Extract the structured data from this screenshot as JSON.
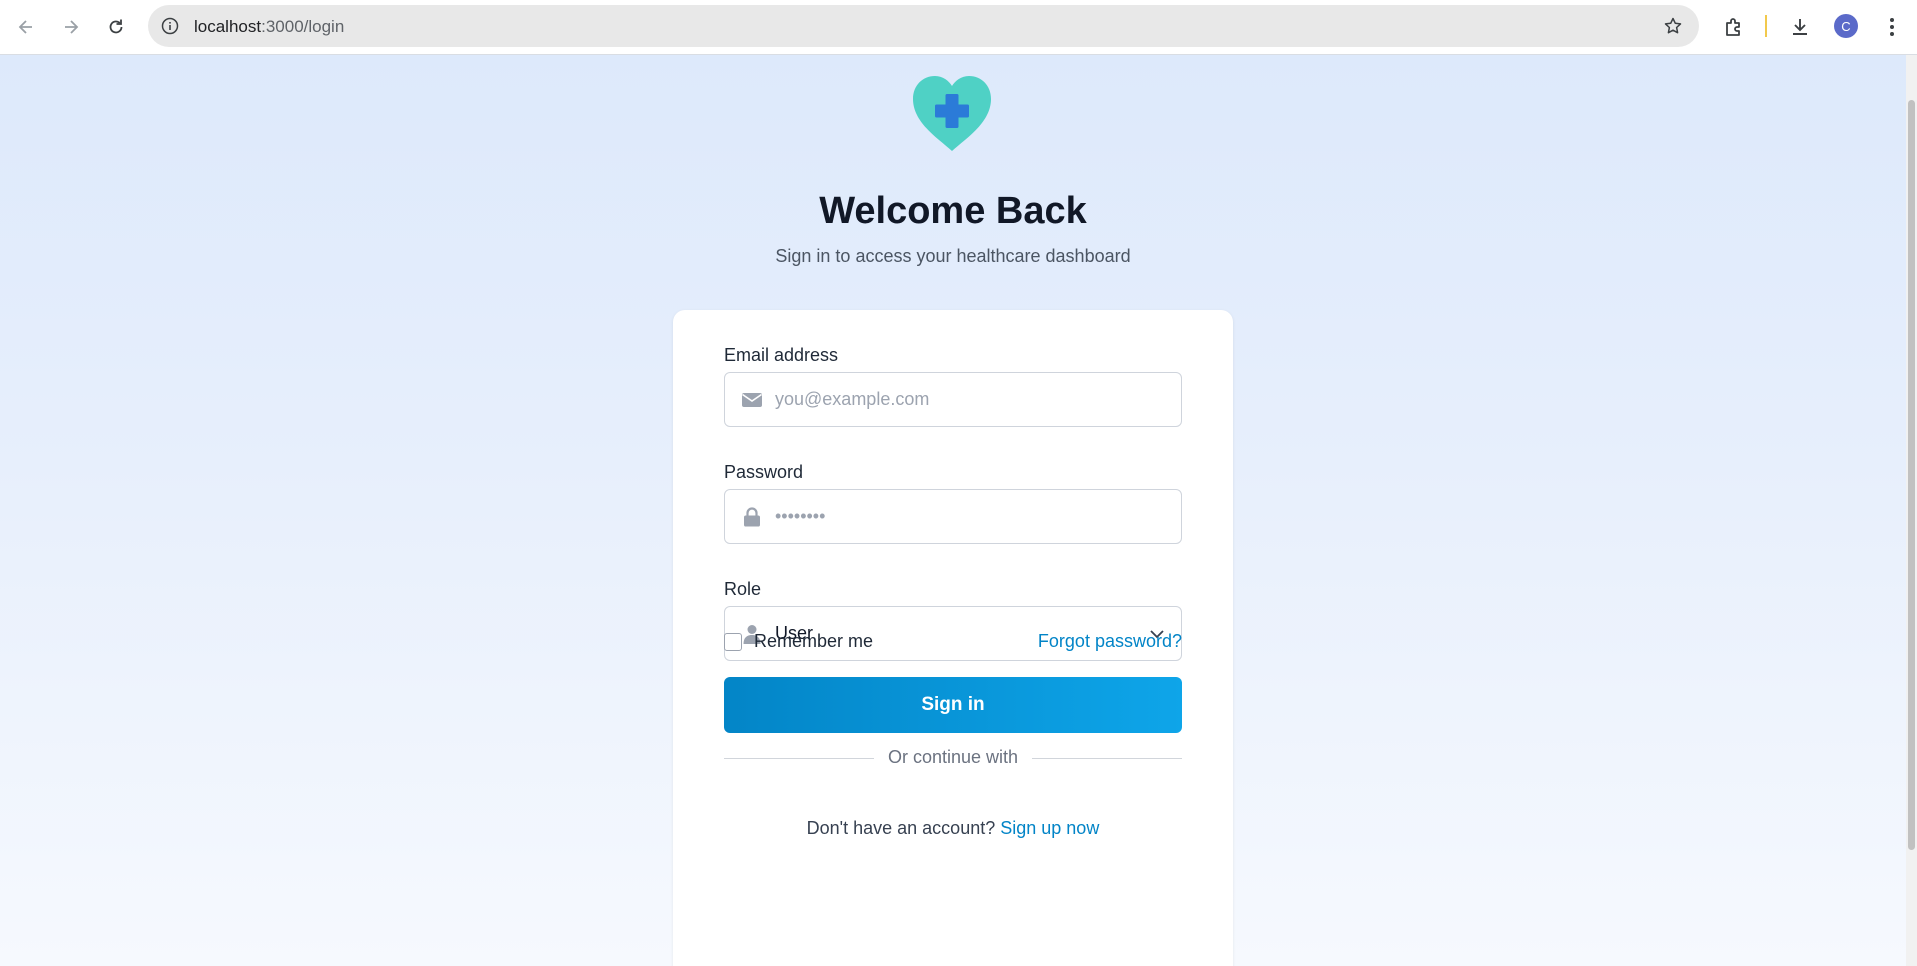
{
  "browser": {
    "url_host": "localhost",
    "url_path": ":3000/login",
    "avatar_letter": "C"
  },
  "header": {
    "title": "Welcome Back",
    "subtitle": "Sign in to access your healthcare dashboard"
  },
  "form": {
    "email_label": "Email address",
    "email_placeholder": "you@example.com",
    "password_label": "Password",
    "password_placeholder": "••••••••",
    "role_label": "Role",
    "role_value": "User",
    "remember_label": "Remember me",
    "forgot_label": "Forgot password?",
    "signin_label": "Sign in",
    "divider_label": "Or continue with",
    "signup_prompt": "Don't have an account?",
    "signup_link": "Sign up now"
  },
  "colors": {
    "accent": "#0284c7",
    "logo_heart": "#4fd1c5",
    "logo_cross": "#2b7bd8"
  }
}
